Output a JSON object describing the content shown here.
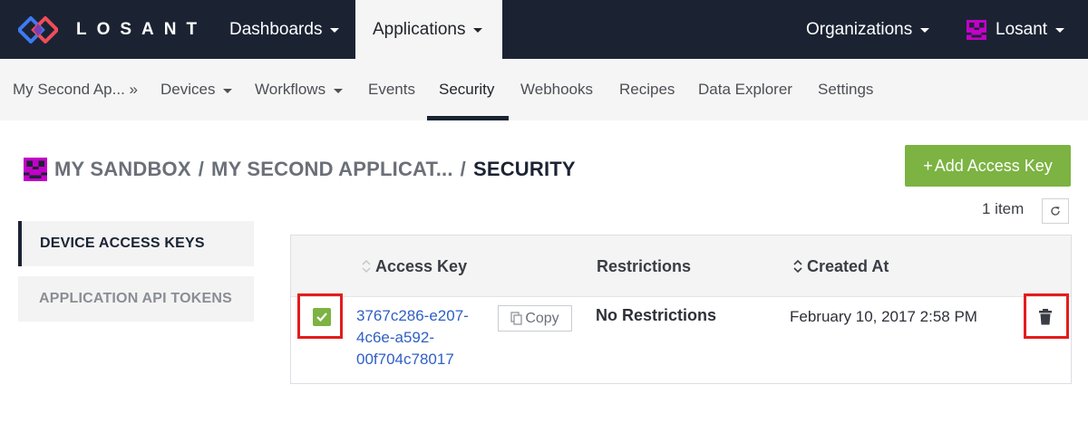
{
  "topnav": {
    "logo_text": "LOSANT",
    "dashboards_label": "Dashboards",
    "applications_label": "Applications",
    "organizations_label": "Organizations",
    "user_label": "Losant"
  },
  "subnav": {
    "app_label": "My Second Ap... »",
    "devices_label": "Devices",
    "workflows_label": "Workflows",
    "events_label": "Events",
    "security_label": "Security",
    "webhooks_label": "Webhooks",
    "recipes_label": "Recipes",
    "data_explorer_label": "Data Explorer",
    "settings_label": "Settings"
  },
  "breadcrumb": {
    "sandbox": "MY SANDBOX",
    "application": "MY SECOND APPLICAT...",
    "separator": "/",
    "current": "SECURITY"
  },
  "add_button": {
    "plus": "+",
    "label": "Add Access Key"
  },
  "item_count": "1 item",
  "side_tabs": {
    "device_access_keys": "DEVICE ACCESS KEYS",
    "application_api_tokens": "APPLICATION API TOKENS"
  },
  "table": {
    "headers": {
      "access_key": "Access Key",
      "restrictions": "Restrictions",
      "created_at": "Created At"
    },
    "rows": [
      {
        "key_line1": "3767c286-e207-",
        "key_line2": "4c6e-a592-",
        "key_line3": "00f704c78017",
        "copy_label": "Copy",
        "restrictions": "No Restrictions",
        "created_at": "February 10, 2017 2:58 PM",
        "checked": true
      }
    ]
  },
  "colors": {
    "nav_bg": "#1b2333",
    "subnav_bg": "#f5f5f5",
    "accent_green": "#7cb342",
    "link_blue": "#2f5fc5",
    "highlight_red": "#e31c1c",
    "logo_blue": "#3d7bf2",
    "logo_red": "#f04d5a",
    "avatar_magenta": "#c300c8"
  },
  "icons": {
    "logo": "losant-diamond-logo-icon",
    "avatar": "pixel-avatar-icon",
    "sort": "sort-arrows-icon",
    "copy": "copy-icon",
    "refresh": "refresh-icon",
    "delete": "trash-icon",
    "checkbox": "checkmark-icon"
  }
}
